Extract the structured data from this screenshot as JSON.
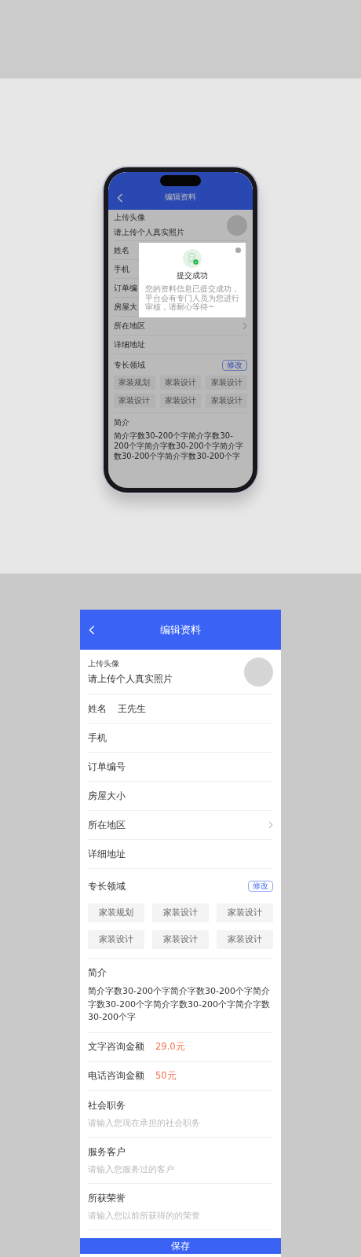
{
  "mockup": {
    "header": {
      "title": "编辑资料"
    },
    "rows": [
      {
        "kind": "avatar",
        "caption": "上传头像",
        "label": "请上传个人真实照片"
      },
      {
        "kind": "field",
        "label": "姓名"
      },
      {
        "kind": "field",
        "label": "手机"
      },
      {
        "kind": "field",
        "label": "订单编"
      },
      {
        "kind": "field",
        "label": "房屋大"
      },
      {
        "kind": "link",
        "label": "所在地区"
      },
      {
        "kind": "field",
        "label": "详细地址"
      },
      {
        "kind": "tags",
        "label": "专长领域",
        "action": "修改",
        "tags": [
          "家装规划",
          "家装设计",
          "家装设计",
          "家装设计",
          "家装设计",
          "家装设计"
        ]
      },
      {
        "kind": "intro",
        "label": "简介",
        "text": "简介字数30-200个字简介字数30-200个字简介字数30-200个字简介字数30-200个字简介字数30-200个字"
      }
    ],
    "dialog": {
      "title": "提交成功",
      "message": "您的资料信息已提交成功，平台会有专门人员为您进行审核，请耐心等待~"
    }
  },
  "screen": {
    "header": {
      "title": "编辑资料"
    },
    "rows": [
      {
        "kind": "avatar",
        "caption": "上传头像",
        "label": "请上传个人真实照片"
      },
      {
        "kind": "field",
        "label": "姓名",
        "value": "王先生"
      },
      {
        "kind": "field",
        "label": "手机"
      },
      {
        "kind": "field",
        "label": "订单编号"
      },
      {
        "kind": "field",
        "label": "房屋大小"
      },
      {
        "kind": "link",
        "label": "所在地区"
      },
      {
        "kind": "field",
        "label": "详细地址"
      },
      {
        "kind": "tags",
        "label": "专长领域",
        "action": "修改",
        "tags": [
          "家装规划",
          "家装设计",
          "家装设计",
          "家装设计",
          "家装设计",
          "家装设计"
        ]
      },
      {
        "kind": "intro",
        "label": "简介",
        "text": "简介字数30-200个字简介字数30-200个字简介字数30-200个字简介字数30-200个字简介字数30-200个字"
      },
      {
        "kind": "price",
        "label": "文字咨询金额",
        "value": "29.0元"
      },
      {
        "kind": "price",
        "label": "电话咨询金额",
        "value": "50元"
      },
      {
        "kind": "input",
        "label": "社会职务",
        "placeholder": "请输入您现在承担的社会职务"
      },
      {
        "kind": "input",
        "label": "服务客户",
        "placeholder": "请输入您服务过的客户"
      },
      {
        "kind": "input",
        "label": "所获荣誉",
        "placeholder": "请输入您以前所获得的的荣誉"
      }
    ],
    "button": "保存"
  }
}
